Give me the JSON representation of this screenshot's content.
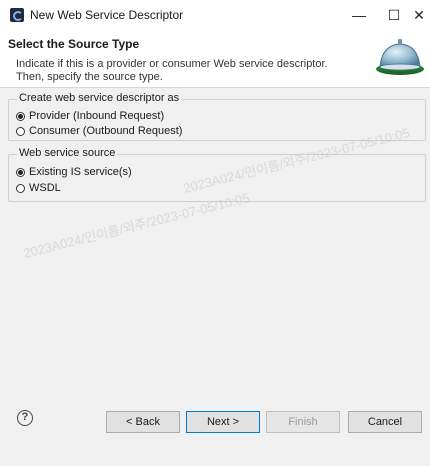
{
  "window": {
    "title": "New Web Service Descriptor",
    "minimize_glyph": "—",
    "maximize_glyph": "☐",
    "close_glyph": "✕"
  },
  "banner": {
    "title": "Select the Source Type",
    "description": "Indicate if this is a provider or consumer Web service descriptor. Then, specify the source type."
  },
  "descriptor_group": {
    "label": "Create web service descriptor as",
    "options": [
      {
        "label": "Provider (Inbound Request)",
        "checked": true
      },
      {
        "label": "Consumer (Outbound Request)",
        "checked": false
      }
    ]
  },
  "source_group": {
    "label": "Web service source",
    "options": [
      {
        "label": "Existing IS service(s)",
        "checked": true
      },
      {
        "label": "WSDL",
        "checked": false
      }
    ]
  },
  "footer": {
    "help_glyph": "?",
    "back_label": "< Back",
    "next_label": "Next >",
    "finish_label": "Finish",
    "cancel_label": "Cancel"
  },
  "watermark": {
    "line1": "2023A024/민이름/외주/2023-07-05/10:05",
    "line2": "2023A024/민이름/외주/2023-07-05/10:05"
  },
  "colors": {
    "accent": "#0078d7",
    "window_bg": "#f0f0f0",
    "banner_bg": "#ffffff"
  }
}
